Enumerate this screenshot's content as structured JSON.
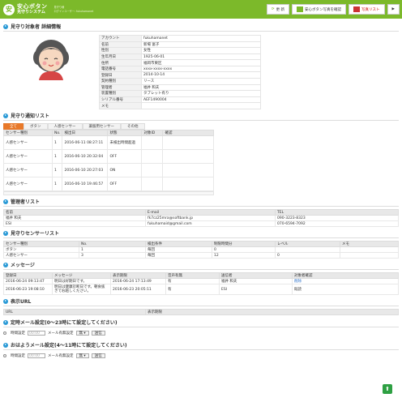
{
  "header": {
    "logo_mark": "安",
    "logo_title": "安心ボタン",
    "logo_sub": "見守りシステム",
    "sub1": "見守り様",
    "sub2": "ログインユーザー: fukuhamanet",
    "btn_refresh": "更 新",
    "btn_register": "安心ボタン写真を確認",
    "btn_photo_list": "写真リスト",
    "btn_next": "▶"
  },
  "subject": {
    "title": "見守り対象者 詳細情報",
    "fields": [
      {
        "label": "アカウント",
        "value": "fukuhamanet"
      },
      {
        "label": "名前",
        "value": "新場 富子"
      },
      {
        "label": "性別",
        "value": "女性"
      },
      {
        "label": "生年月日",
        "value": "1925-06-01"
      },
      {
        "label": "住所",
        "value": "福岡市東区"
      },
      {
        "label": "電話番号",
        "value": "xxxx-xxxx-xxxx"
      },
      {
        "label": "登録日",
        "value": "2014-10-14"
      },
      {
        "label": "契約種別",
        "value": "リース"
      },
      {
        "label": "管理者",
        "value": "福井 和夫"
      },
      {
        "label": "装置種別",
        "value": "タブレット有り"
      },
      {
        "label": "シリアル番号",
        "value": "AEF1490004"
      },
      {
        "label": "メモ",
        "value": ""
      }
    ]
  },
  "notify": {
    "title": "見守り通知リスト",
    "tabs": [
      "全て",
      "ボタン",
      "人感センサー",
      "薬服用センサー",
      "その他"
    ],
    "headers": [
      "センサー種別",
      "No.",
      "検出日",
      "状態",
      "対象ID",
      "確認"
    ],
    "rows": [
      [
        "人感センサー",
        "1",
        "2016-06-11 08:27:11",
        "未検出時間超過",
        "",
        ""
      ],
      [
        "人感センサー",
        "1",
        "2016-06-10 20:32:04",
        "OFF",
        "",
        ""
      ],
      [
        "人感センサー",
        "1",
        "2016-06-10 20:27:03",
        "ON",
        "",
        ""
      ],
      [
        "人感センサー",
        "1",
        "2016-06-10 19:46:57",
        "OFF",
        "",
        ""
      ]
    ]
  },
  "admins": {
    "title": "管理者リスト",
    "headers": [
      "名前",
      "E-mail",
      "TEL"
    ],
    "rows": [
      [
        "福井 和夫",
        "fk7cz25mra@softbank.jp",
        "090-3223-8323"
      ],
      [
        "ESI",
        "fukuhamaid@gmail.com",
        "070-6594-7092"
      ]
    ]
  },
  "sensors": {
    "title": "見守りセンサーリスト",
    "headers": [
      "センサー種別",
      "No.",
      "検出条件",
      "制限時間分",
      "レベル",
      "メモ"
    ],
    "rows": [
      [
        "ボタン",
        "1",
        "毎回",
        "0",
        "",
        ""
      ],
      [
        "人感センサー",
        "3",
        "毎回",
        "12",
        "0",
        ""
      ]
    ]
  },
  "messages": {
    "title": "メッセージ",
    "headers": [
      "登録日",
      "メッセージ",
      "表示期限",
      "音声有無",
      "送信者",
      "対象者確認"
    ],
    "rows": [
      [
        "2016-06-24 09:13:47",
        "明日は好期日です。",
        "2016-06-24 17:13:49",
        "有",
        "福井 和夫",
        "削除"
      ],
      [
        "2016-06-23 19:08:10",
        "明日は健康診断日です。朝食抜きでお越しください。",
        "2016-06-23 20:05:11",
        "有",
        "ESI",
        "既読"
      ]
    ]
  },
  "urls": {
    "title": "表示URL",
    "headers": [
      "URL",
      "表示期限"
    ]
  },
  "mail_a": {
    "title": "定時メール設定(0〜23時にて設定してください)",
    "time_label": "時間設定",
    "time_placeholder": "00:00",
    "mail_label": "メール有無設定",
    "select_value": "無",
    "btn": "送信"
  },
  "mail_b": {
    "title": "おはようメール設定(4〜11時にて設定してください)",
    "time_label": "時間設定",
    "time_placeholder": "00:00",
    "mail_label": "メール有無設定",
    "select_value": "無",
    "btn": "送信"
  },
  "fab": "⬆"
}
